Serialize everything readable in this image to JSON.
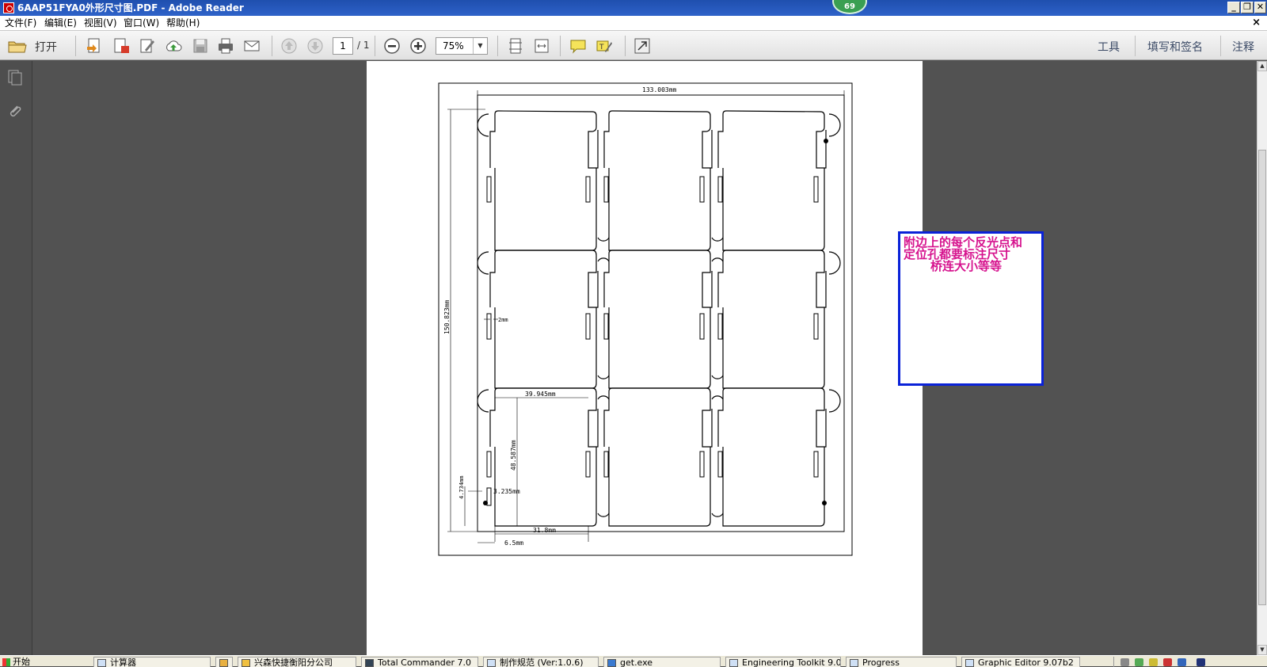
{
  "window": {
    "title": "6AAP51FYA0外形尺寸图.PDF - Adobe Reader",
    "badge": "69",
    "controls": {
      "minimize": "_",
      "restore": "❐",
      "close": "✕"
    }
  },
  "menubar": {
    "items": [
      "文件(F)",
      "编辑(E)",
      "视图(V)",
      "窗口(W)",
      "帮助(H)"
    ],
    "close_doc": "×"
  },
  "toolbar": {
    "open_label": "打开",
    "page_current": "1",
    "page_total": "/ 1",
    "zoom": "75%",
    "right_tools": [
      "工具",
      "填写和签名",
      "注释"
    ]
  },
  "drawing": {
    "dim_width": "133.003mm",
    "dim_height": "150.823mm",
    "dim_slot_width": "2mm",
    "dim_cell_width": "39.945mm",
    "dim_cell_height": "48.587mm",
    "dim_fiducial_y": "4.734mm",
    "dim_fiducial_x": "3.235mm",
    "dim_bottom_width": "31.8mm",
    "dim_offset": "6.5mm"
  },
  "comment": {
    "line1": "附边上的每个反光点和",
    "line2": "定位孔都要标注尺寸",
    "line3": "桥连大小等等"
  },
  "taskbar": {
    "start": "开始",
    "items": [
      "计算器",
      "",
      "兴森快捷衡阳分公司",
      "Total Commander 7.0",
      "制作规范 (Ver:1.0.6)",
      "get.exe",
      "Engineering Toolkit 9.0",
      "Progress",
      "Graphic Editor 9.07b2"
    ]
  },
  "colors": {
    "titlebar": "#2a5bc0",
    "comment_border": "#0a22d8",
    "comment_text": "#d6138e",
    "workspace": "#525252"
  }
}
